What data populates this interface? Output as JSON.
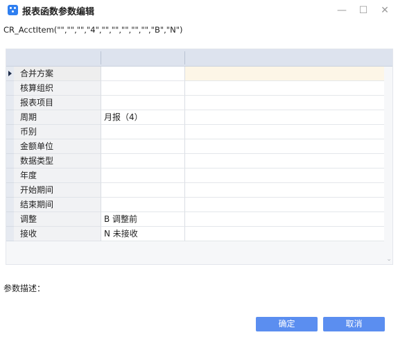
{
  "window": {
    "title": "报表函数参数编辑",
    "icon": "report-app-icon",
    "controls": {
      "minimize": "—",
      "maximize": "☐",
      "close": "✕"
    }
  },
  "formula": "CR_AcctItem(\"\",\"\",\"\",\"4\",\"\",\"\",\"\",\"\",\"\",\"B\",\"N\")",
  "table": {
    "headers": [
      "",
      "",
      ""
    ],
    "rows": [
      {
        "name": "合并方案",
        "value": "",
        "selected": true
      },
      {
        "name": "核算组织",
        "value": ""
      },
      {
        "name": "报表项目",
        "value": ""
      },
      {
        "name": "周期",
        "value": "月报（4）"
      },
      {
        "name": "币别",
        "value": ""
      },
      {
        "name": "金额单位",
        "value": ""
      },
      {
        "name": "数据类型",
        "value": ""
      },
      {
        "name": "年度",
        "value": ""
      },
      {
        "name": "开始期间",
        "value": ""
      },
      {
        "name": "结束期间",
        "value": ""
      },
      {
        "name": "调整",
        "value": "B  调整前"
      },
      {
        "name": "接收",
        "value": "N  未接收"
      }
    ]
  },
  "description": {
    "label": "参数描述："
  },
  "buttons": {
    "ok": "确定",
    "cancel": "取消"
  },
  "colors": {
    "accent": "#5b8ef0",
    "header": "#dde3ee",
    "selected_row": "#fdf6e7"
  }
}
